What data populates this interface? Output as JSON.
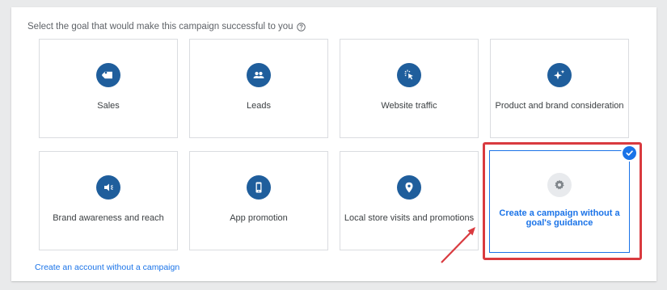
{
  "prompt": {
    "text": "Select the goal that would make this campaign successful to you"
  },
  "goals": [
    {
      "label": "Sales",
      "icon": "tag-icon"
    },
    {
      "label": "Leads",
      "icon": "people-icon"
    },
    {
      "label": "Website traffic",
      "icon": "cursor-click-icon"
    },
    {
      "label": "Product and brand consideration",
      "icon": "sparkle-icon"
    },
    {
      "label": "Brand awareness and reach",
      "icon": "megaphone-icon"
    },
    {
      "label": "App promotion",
      "icon": "phone-icon"
    },
    {
      "label": "Local store visits and promotions",
      "icon": "location-pin-icon"
    },
    {
      "label": "Create a campaign without a goal's guidance",
      "icon": "gear-icon",
      "selected": true
    }
  ],
  "bottom_link": {
    "text": "Create an account without a campaign"
  },
  "colors": {
    "accent": "#1a73e8",
    "icon_bg": "#1f5e9c",
    "annotation_red": "#d93a3f"
  }
}
